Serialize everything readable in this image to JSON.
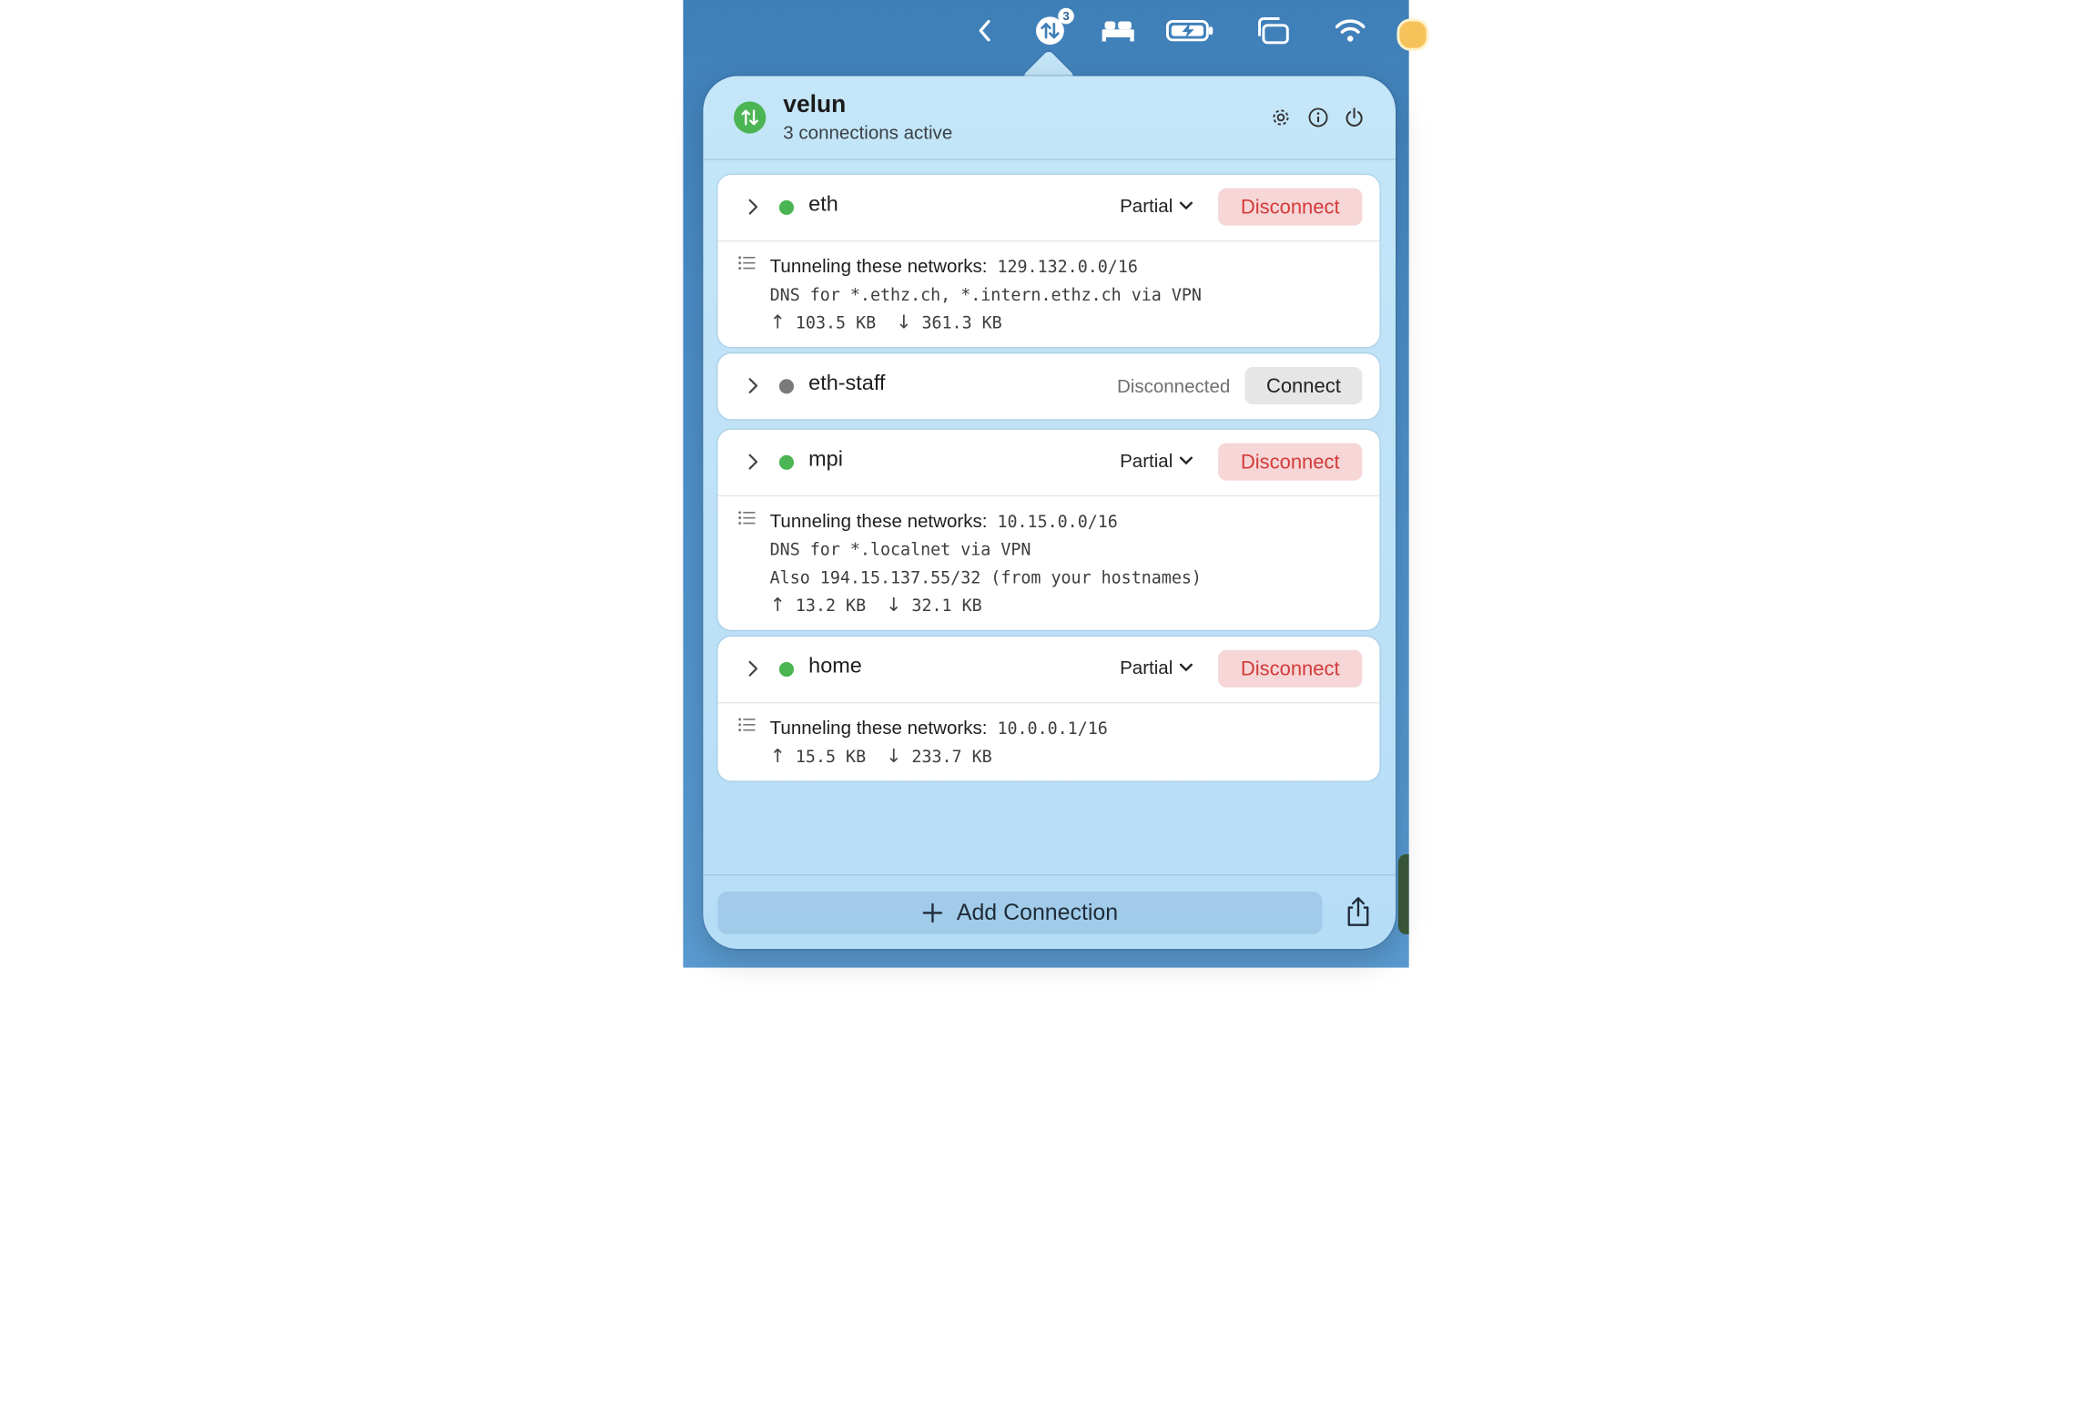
{
  "menubar": {
    "badge_count": "3"
  },
  "app": {
    "name": "velun",
    "status": "3 connections active"
  },
  "connections": [
    {
      "name": "eth",
      "mode": "Partial",
      "action": "Disconnect",
      "tunnel_label": "Tunneling these networks:",
      "tunnel_networks": "129.132.0.0/16",
      "details": [
        "DNS for *.ethz.ch, *.intern.ethz.ch via VPN"
      ],
      "upload": "103.5 KB",
      "download": "361.3 KB"
    },
    {
      "name": "eth-staff",
      "status": "Disconnected",
      "action": "Connect"
    },
    {
      "name": "mpi",
      "mode": "Partial",
      "action": "Disconnect",
      "tunnel_label": "Tunneling these networks:",
      "tunnel_networks": "10.15.0.0/16",
      "details": [
        "DNS for *.localnet via VPN",
        "Also 194.15.137.55/32 (from your hostnames)"
      ],
      "upload": "13.2 KB",
      "download": "32.1 KB"
    },
    {
      "name": "home",
      "mode": "Partial",
      "action": "Disconnect",
      "tunnel_label": "Tunneling these networks:",
      "tunnel_networks": "10.0.0.1/16",
      "upload": "15.5 KB",
      "download": "233.7 KB"
    }
  ],
  "footer": {
    "add_label": "Add Connection"
  },
  "colors": {
    "active_dot": "#4bb453",
    "inactive_dot": "#7a7a7a",
    "disconnect_text": "#d43a3a",
    "disconnect_bg": "#f6d6d6"
  }
}
